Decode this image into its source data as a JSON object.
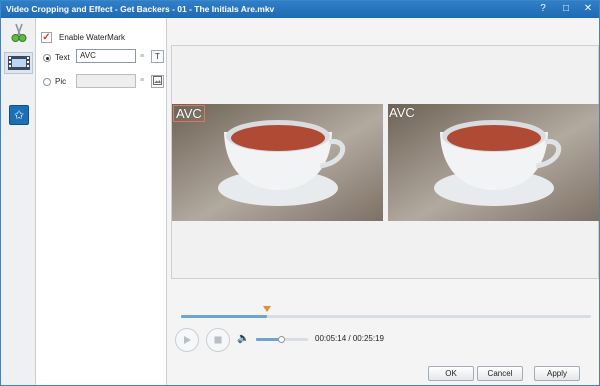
{
  "window": {
    "title": "Video Cropping and Effect - Get Backers - 01 - The Initials Are.mkv",
    "help_label": "?",
    "maximize_label": "□",
    "close_label": "✕"
  },
  "tabs": [
    {
      "name": "crop",
      "icon": "scissors-icon",
      "active": false
    },
    {
      "name": "effect",
      "icon": "film-strip-icon",
      "active": true
    },
    {
      "name": "watermark",
      "icon": "star-icon",
      "active": false
    }
  ],
  "watermark": {
    "enable_label": "Enable WaterMark",
    "enabled": true,
    "text_label": "Text",
    "text_value": "AVC",
    "pic_label": "Pic",
    "pic_value": "",
    "selected_mode": "Text"
  },
  "preview": {
    "left_watermark": "AVC",
    "right_watermark": "AVC"
  },
  "player": {
    "progress": 0.21,
    "volume": 0.48,
    "current_time": "00:05:14",
    "total_time": "00:25:19",
    "time_separator": "/"
  },
  "footer": {
    "ok_label": "OK",
    "cancel_label": "Cancel",
    "apply_label": "Apply"
  },
  "colors": {
    "titlebar": "#1f6ab3",
    "accent": "#6ea4d2",
    "marker": "#e78d2c",
    "tea": "#b04a34"
  }
}
